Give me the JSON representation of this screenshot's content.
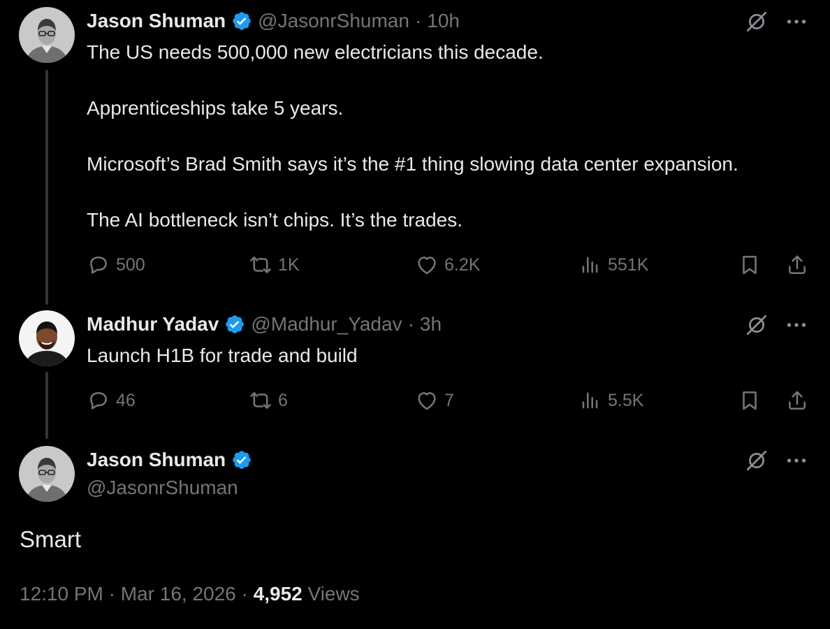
{
  "colors": {
    "background": "#000000",
    "text": "#e7e9ea",
    "muted": "#71767b",
    "verified": "#1d9bf0",
    "thread_line": "#333639"
  },
  "tweets": [
    {
      "name": "Jason Shuman",
      "handle": "@JasonrShuman",
      "separator": "·",
      "time": "10h",
      "avatar_icon": "avatar-man-glasses",
      "text": [
        "The US needs 500,000 new electricians this decade.",
        "Apprenticeships take 5 years.",
        "Microsoft’s Brad Smith says it’s the #1 thing slowing data center expansion.",
        "The AI bottleneck isn’t chips. It’s the trades."
      ],
      "replies": "500",
      "reposts": "1K",
      "likes": "6.2K",
      "views": "551K"
    },
    {
      "name": "Madhur Yadav",
      "handle": "@Madhur_Yadav",
      "separator": "·",
      "time": "3h",
      "avatar_icon": "avatar-smiling-man",
      "text": [
        "Launch H1B for trade and build"
      ],
      "replies": "46",
      "reposts": "6",
      "likes": "7",
      "views": "5.5K"
    }
  ],
  "focus": {
    "name": "Jason Shuman",
    "handle": "@JasonrShuman",
    "text": "Smart",
    "time": "12:10 PM",
    "date": "Mar 16, 2026",
    "separator": "·",
    "views_count": "4,952",
    "views_label": "Views"
  },
  "icons": [
    "verified-badge-icon",
    "grok-icon",
    "more-icon",
    "reply-icon",
    "repost-icon",
    "like-icon",
    "views-icon",
    "bookmark-icon",
    "share-icon"
  ]
}
